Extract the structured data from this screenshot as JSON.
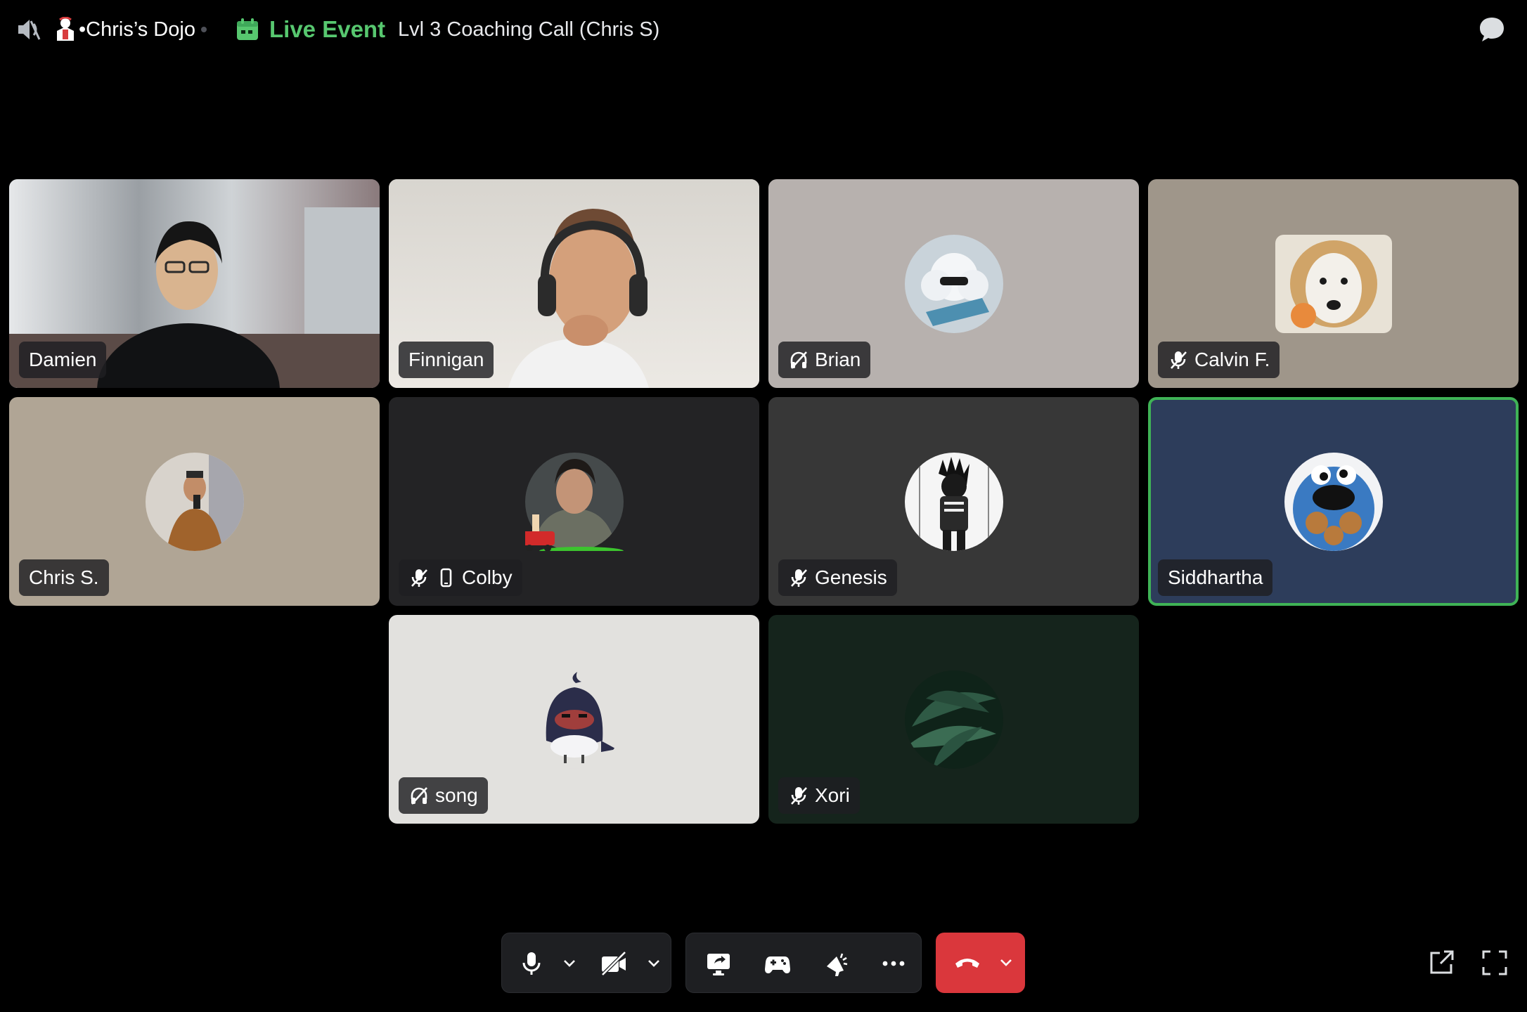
{
  "topbar": {
    "voice_status_icon": "speaker-muted-icon",
    "server_icon": "dojo-server-icon",
    "channel_name": "•Chris’s Dojo",
    "event_icon": "calendar-icon",
    "event_status": "Live Event",
    "event_title": "Lvl 3 Coaching Call (Chris S)",
    "chat_icon": "chat-bubble-icon"
  },
  "colors": {
    "live_green": "#57c76f",
    "speaking_border": "#3fb356",
    "hangup_red": "#da373c",
    "background": "#000000"
  },
  "participants": [
    {
      "name": "Damien",
      "video": true,
      "status_icons": []
    },
    {
      "name": "Finnigan",
      "video": true,
      "status_icons": []
    },
    {
      "name": "Brian",
      "video": false,
      "status_icons": [
        "deafened-icon"
      ],
      "bg": "#b7b1ae"
    },
    {
      "name": "Calvin F.",
      "video": false,
      "status_icons": [
        "muted-icon"
      ],
      "bg": "#9f968a"
    },
    {
      "name": "Chris S.",
      "video": false,
      "status_icons": [],
      "bg": "#b0a595"
    },
    {
      "name": "Colby",
      "video": false,
      "status_icons": [
        "muted-icon",
        "mobile-icon"
      ],
      "bg": "#232325"
    },
    {
      "name": "Genesis",
      "video": false,
      "status_icons": [
        "muted-icon"
      ],
      "bg": "#373737"
    },
    {
      "name": "Siddhartha",
      "video": false,
      "status_icons": [],
      "bg": "#2d3d5b",
      "speaking": true
    },
    {
      "name": "song",
      "video": false,
      "status_icons": [
        "deafened-icon"
      ],
      "bg": "#e2e1de"
    },
    {
      "name": "Xori",
      "video": false,
      "status_icons": [
        "muted-icon"
      ],
      "bg": "#15241c"
    }
  ],
  "controls": {
    "left_group": [
      "microphone-icon",
      "chevron-down-icon",
      "camera-off-icon",
      "chevron-down-icon"
    ],
    "middle_group": [
      "screen-share-icon",
      "activities-controller-icon",
      "soundboard-icon",
      "more-icon"
    ],
    "hangup": [
      "hangup-icon",
      "chevron-down-icon"
    ],
    "right": [
      "pop-out-icon",
      "fullscreen-icon"
    ]
  }
}
